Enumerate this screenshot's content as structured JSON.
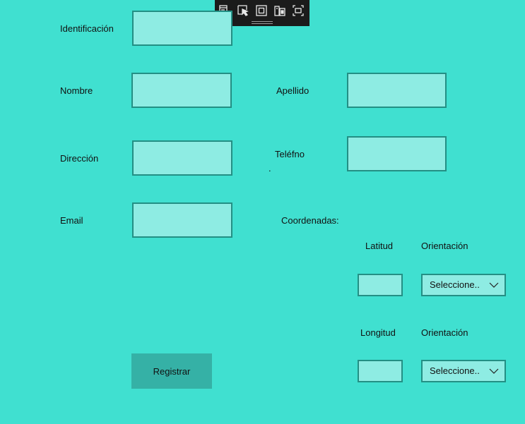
{
  "toolbar": {
    "tools": [
      {
        "icon": "visual-tree-icon"
      },
      {
        "icon": "select-element-icon"
      },
      {
        "icon": "display-layout-adorners-icon"
      },
      {
        "icon": "track-focused-element-icon"
      },
      {
        "icon": "display-layout-icon"
      }
    ]
  },
  "form": {
    "identificacion": {
      "label": "Identificación",
      "value": ""
    },
    "nombre": {
      "label": "Nombre",
      "value": ""
    },
    "apellido": {
      "label": "Apellido",
      "value": ""
    },
    "direccion": {
      "label": "Dirección",
      "value": ""
    },
    "telefono": {
      "label": "Teléfno",
      "dot": ".",
      "value": ""
    },
    "email": {
      "label": "Email",
      "value": ""
    },
    "coordenadas": {
      "label": "Coordenadas:"
    },
    "latitud": {
      "label": "Latitud",
      "value": ""
    },
    "longitud": {
      "label": "Longitud",
      "value": ""
    },
    "orientacion_lat": {
      "label": "Orientación",
      "selected": "Seleccione.."
    },
    "orientacion_lon": {
      "label": "Orientación",
      "selected": "Seleccione.."
    }
  },
  "actions": {
    "register_label": "Registrar"
  },
  "colors": {
    "background": "#40e0d0",
    "input_fill": "#8eece3",
    "input_border": "#238f84",
    "button_fill": "#35b1a6",
    "toolbar_bg": "#1b1b1b"
  }
}
